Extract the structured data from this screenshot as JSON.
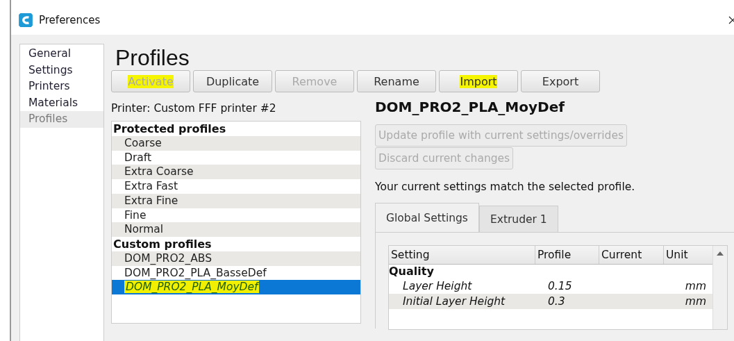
{
  "window": {
    "title": "Preferences"
  },
  "sidebar": {
    "items": [
      {
        "label": "General",
        "selected": false
      },
      {
        "label": "Settings",
        "selected": false
      },
      {
        "label": "Printers",
        "selected": false
      },
      {
        "label": "Materials",
        "selected": false
      },
      {
        "label": "Profiles",
        "selected": true
      }
    ]
  },
  "heading": "Profiles",
  "toolbar": [
    {
      "label": "Activate",
      "disabled": true,
      "highlighted": true
    },
    {
      "label": "Duplicate",
      "disabled": false,
      "highlighted": false
    },
    {
      "label": "Remove",
      "disabled": true,
      "highlighted": false
    },
    {
      "label": "Rename",
      "disabled": false,
      "highlighted": false
    },
    {
      "label": "Import",
      "disabled": false,
      "highlighted": true
    },
    {
      "label": "Export",
      "disabled": false,
      "highlighted": false
    }
  ],
  "printer_label": "Printer: Custom FFF printer #2",
  "profiles": [
    {
      "kind": "header",
      "label": "Protected profiles"
    },
    {
      "kind": "item",
      "label": "Coarse",
      "selected": false,
      "highlighted": false
    },
    {
      "kind": "item",
      "label": "Draft",
      "selected": false,
      "highlighted": false
    },
    {
      "kind": "item",
      "label": "Extra Coarse",
      "selected": false,
      "highlighted": false
    },
    {
      "kind": "item",
      "label": "Extra Fast",
      "selected": false,
      "highlighted": false
    },
    {
      "kind": "item",
      "label": "Extra Fine",
      "selected": false,
      "highlighted": false
    },
    {
      "kind": "item",
      "label": "Fine",
      "selected": false,
      "highlighted": false
    },
    {
      "kind": "item",
      "label": "Normal",
      "selected": false,
      "highlighted": false
    },
    {
      "kind": "header",
      "label": "Custom profiles"
    },
    {
      "kind": "item",
      "label": "DOM_PRO2_ABS",
      "selected": false,
      "highlighted": false
    },
    {
      "kind": "item",
      "label": "DOM_PRO2_PLA_BasseDef",
      "selected": false,
      "highlighted": false
    },
    {
      "kind": "item",
      "label": "DOM_PRO2_PLA_MoyDef",
      "selected": true,
      "highlighted": true
    }
  ],
  "detail": {
    "title": "DOM_PRO2_PLA_MoyDef",
    "actions": [
      {
        "label": "Update profile with current settings/overrides",
        "disabled": true
      },
      {
        "label": "Discard current changes",
        "disabled": true
      }
    ],
    "message": "Your current settings match the selected profile.",
    "tabs": [
      {
        "label": "Global Settings",
        "selected": true
      },
      {
        "label": "Extruder 1",
        "selected": false
      }
    ],
    "table": {
      "columns": [
        "Setting",
        "Profile",
        "Current",
        "Unit"
      ],
      "rows": [
        {
          "kind": "category",
          "label": "Quality"
        },
        {
          "kind": "setting",
          "setting": "Layer Height",
          "profile": "0.15",
          "unit": "mm"
        },
        {
          "kind": "setting",
          "setting": "Initial Layer Height",
          "profile": "0.3",
          "unit": "mm"
        }
      ]
    }
  }
}
